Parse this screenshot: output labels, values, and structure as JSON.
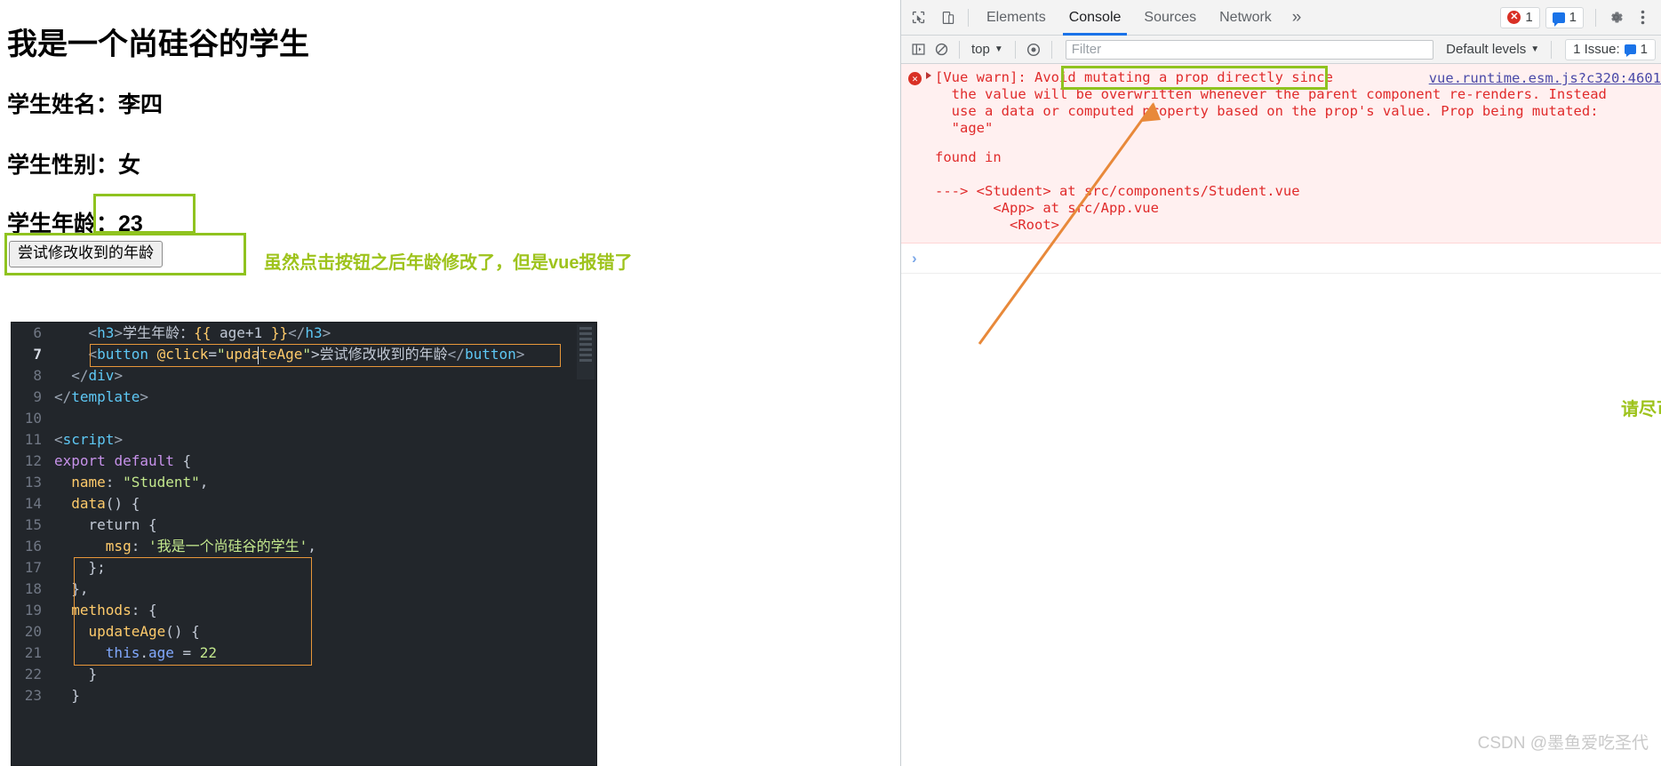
{
  "page": {
    "title": "我是一个尚硅谷的学生",
    "name_line": "学生姓名：李四",
    "gender_line": "学生性别：女",
    "age_line": "学生年龄：23",
    "button_label": "尝试修改收到的年龄",
    "note_left": "虽然点击按钮之后年龄修改了，但是vue报错了",
    "note_right": "请尽可能避免去修改属性值传入的",
    "highlight_color": "#8fc31f",
    "annotation_arrow_color": "#e8893a"
  },
  "editor": {
    "lines": [
      {
        "num": "6",
        "current": false
      },
      {
        "num": "7",
        "current": true
      },
      {
        "num": "8",
        "current": false
      },
      {
        "num": "9",
        "current": false
      },
      {
        "num": "10",
        "current": false
      },
      {
        "num": "11",
        "current": false
      },
      {
        "num": "12",
        "current": false
      },
      {
        "num": "13",
        "current": false
      },
      {
        "num": "14",
        "current": false
      },
      {
        "num": "15",
        "current": false
      },
      {
        "num": "16",
        "current": false
      },
      {
        "num": "17",
        "current": false
      },
      {
        "num": "18",
        "current": false
      },
      {
        "num": "19",
        "current": false
      },
      {
        "num": "20",
        "current": false
      },
      {
        "num": "21",
        "current": false
      },
      {
        "num": "22",
        "current": false
      },
      {
        "num": "23",
        "current": false
      }
    ],
    "code": [
      "    <h3>学生年龄：{{ age+1 }}</h3>",
      "    <button @click=\"updateAge\">尝试修改收到的年龄</button>",
      "  </div>",
      "</template>",
      "",
      "<script>",
      "export default {",
      "  name: \"Student\",",
      "  data() {",
      "    return {",
      "      msg: '我是一个尚硅谷的学生',",
      "    };",
      "  },",
      "  methods: {",
      "    updateAge() {",
      "      this.age = 22",
      "    }",
      "  }"
    ]
  },
  "devtools": {
    "tabs": [
      {
        "label": "Elements",
        "active": false
      },
      {
        "label": "Console",
        "active": true
      },
      {
        "label": "Sources",
        "active": false
      },
      {
        "label": "Network",
        "active": false
      }
    ],
    "more_tabs_glyph": "»",
    "error_count": "1",
    "message_count": "1",
    "context_selector": "top",
    "filter_placeholder": "Filter",
    "levels_selector": "Default levels",
    "issues_label": "1 Issue:",
    "issues_count": "1",
    "prompt_glyph": "›"
  },
  "console": {
    "prefix": "[Vue warn]:",
    "highlighted_phrase": " Avoid mutating a prop directly since",
    "message_rest": "\n  the value will be overwritten whenever the parent component re-renders. Instead\n  use a data or computed property based on the prop's value. Prop being mutated:\n  \"age\"",
    "source_link": "vue.runtime.esm.js?c320:4601",
    "found_in_label": "found in",
    "stack": [
      "---> <Student> at src/components/Student.vue",
      "       <App> at src/App.vue",
      "         <Root>"
    ]
  },
  "watermark": "CSDN @墨鱼爱吃圣代"
}
